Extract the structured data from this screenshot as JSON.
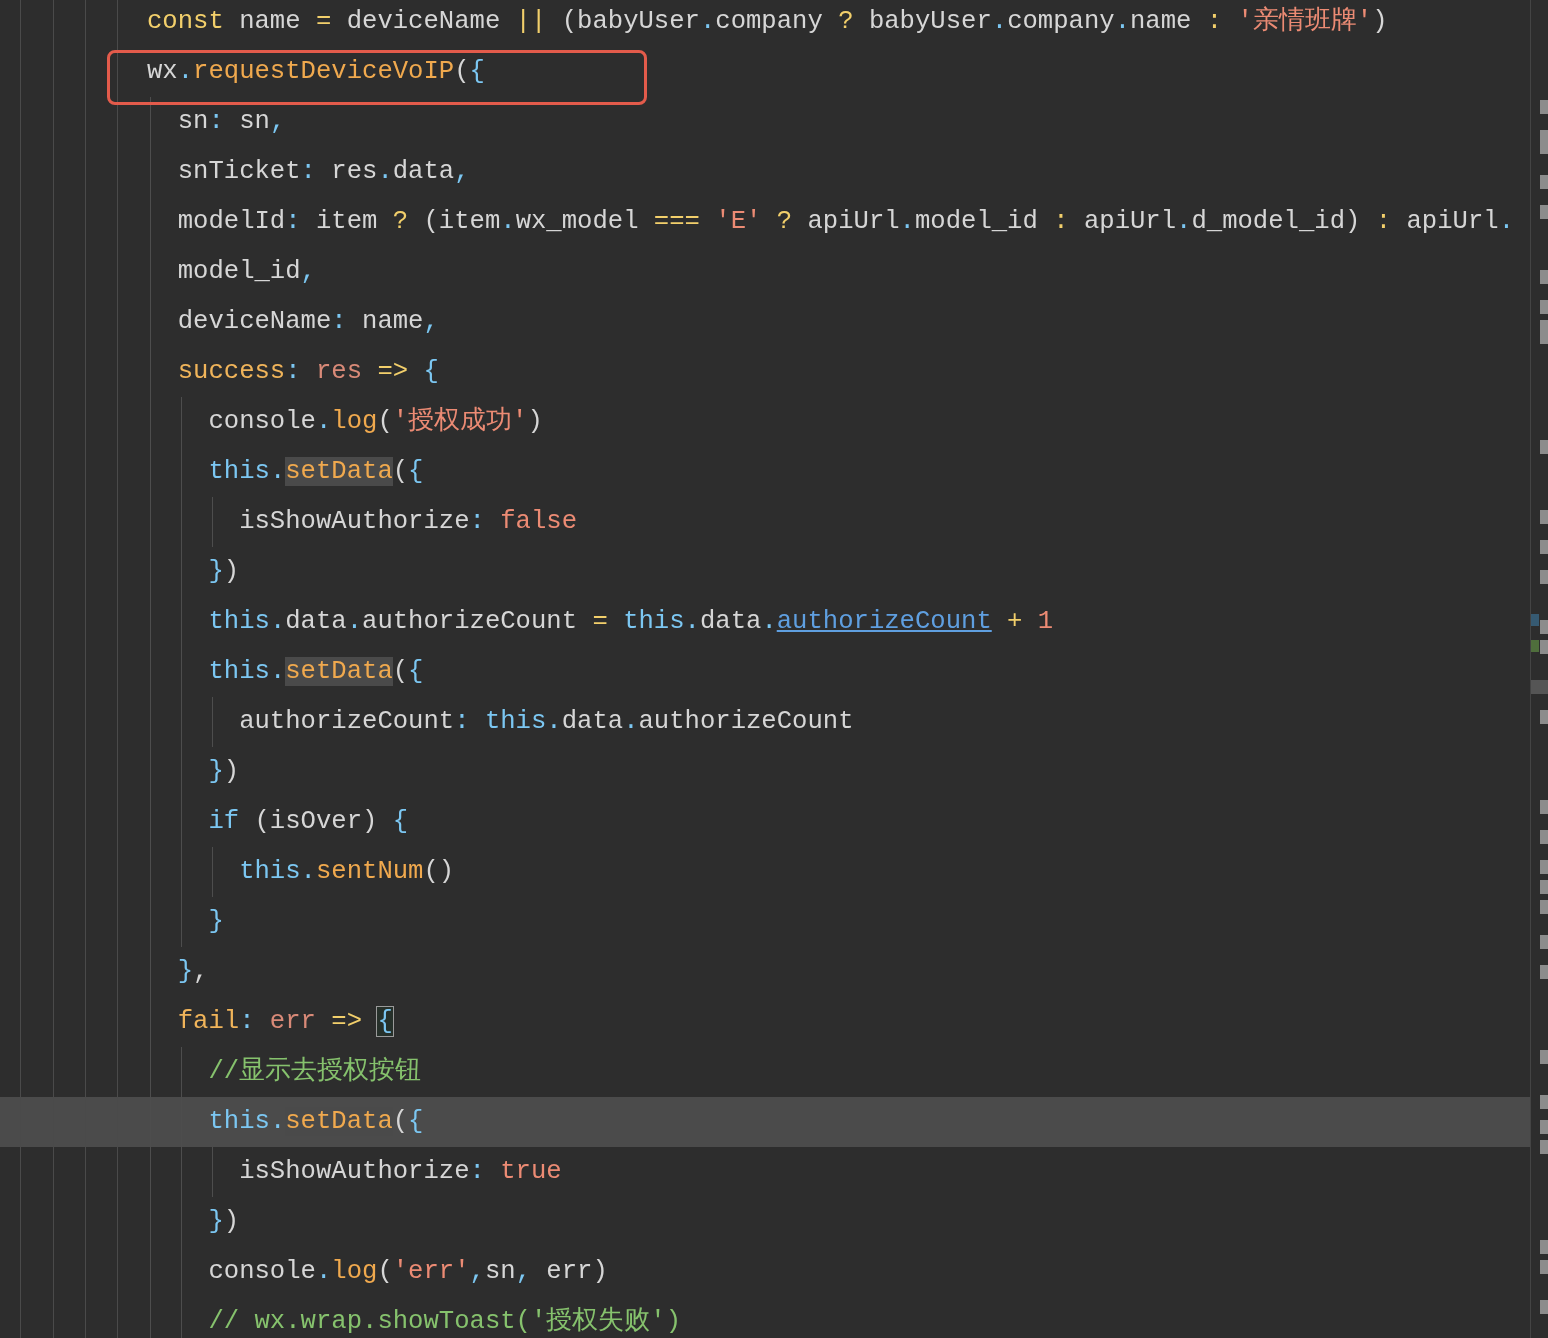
{
  "editor": {
    "lines": [
      {
        "current": false,
        "tokens": [
          {
            "kind": "kw",
            "text": "const"
          },
          {
            "kind": "id",
            "text": " name"
          },
          {
            "kind": "op",
            "text": " ="
          },
          {
            "kind": "id",
            "text": " deviceName"
          },
          {
            "kind": "op",
            "text": " ||"
          },
          {
            "kind": "id",
            "text": " (babyUser"
          },
          {
            "kind": "dot",
            "text": "."
          },
          {
            "kind": "id",
            "text": "company"
          },
          {
            "kind": "op",
            "text": " ?"
          },
          {
            "kind": "id",
            "text": " babyUser"
          },
          {
            "kind": "dot",
            "text": "."
          },
          {
            "kind": "id",
            "text": "company"
          },
          {
            "kind": "dot",
            "text": "."
          },
          {
            "kind": "id",
            "text": "name"
          },
          {
            "kind": "op",
            "text": " :"
          },
          {
            "kind": "str",
            "text": " '亲情班牌'"
          },
          {
            "kind": "id",
            "text": ")"
          }
        ]
      },
      {
        "current": false,
        "tokens": [
          {
            "kind": "id",
            "text": "wx"
          },
          {
            "kind": "dot",
            "text": "."
          },
          {
            "kind": "fn",
            "text": "requestDeviceVoIP"
          },
          {
            "kind": "id",
            "text": "("
          },
          {
            "kind": "brace",
            "text": "{"
          }
        ]
      },
      {
        "current": false,
        "tokens": [
          {
            "kind": "id",
            "text": "  sn"
          },
          {
            "kind": "dot",
            "text": ":"
          },
          {
            "kind": "id",
            "text": " sn"
          },
          {
            "kind": "dot",
            "text": ","
          }
        ]
      },
      {
        "current": false,
        "tokens": [
          {
            "kind": "id",
            "text": "  snTicket"
          },
          {
            "kind": "dot",
            "text": ":"
          },
          {
            "kind": "id",
            "text": " res"
          },
          {
            "kind": "dot",
            "text": "."
          },
          {
            "kind": "id",
            "text": "data"
          },
          {
            "kind": "dot",
            "text": ","
          }
        ]
      },
      {
        "current": false,
        "tokens": [
          {
            "kind": "id",
            "text": "  modelId"
          },
          {
            "kind": "dot",
            "text": ":"
          },
          {
            "kind": "id",
            "text": " item"
          },
          {
            "kind": "op",
            "text": " ?"
          },
          {
            "kind": "id",
            "text": " (item"
          },
          {
            "kind": "dot",
            "text": "."
          },
          {
            "kind": "id",
            "text": "wx_model"
          },
          {
            "kind": "op",
            "text": " ==="
          },
          {
            "kind": "str",
            "text": " 'E'"
          },
          {
            "kind": "op",
            "text": " ?"
          },
          {
            "kind": "id",
            "text": " apiUrl"
          },
          {
            "kind": "dot",
            "text": "."
          },
          {
            "kind": "id",
            "text": "model_id"
          },
          {
            "kind": "op",
            "text": " :"
          },
          {
            "kind": "id",
            "text": " apiUrl"
          },
          {
            "kind": "dot",
            "text": "."
          },
          {
            "kind": "id",
            "text": "d_model_id)"
          },
          {
            "kind": "op",
            "text": " :"
          },
          {
            "kind": "id",
            "text": " apiUrl"
          },
          {
            "kind": "dot",
            "text": "."
          }
        ]
      },
      {
        "current": false,
        "tokens": [
          {
            "kind": "id",
            "text": "  model_id"
          },
          {
            "kind": "dot",
            "text": ","
          }
        ]
      },
      {
        "current": false,
        "tokens": [
          {
            "kind": "id",
            "text": "  deviceName"
          },
          {
            "kind": "dot",
            "text": ":"
          },
          {
            "kind": "id",
            "text": " name"
          },
          {
            "kind": "dot",
            "text": ","
          }
        ]
      },
      {
        "current": false,
        "tokens": [
          {
            "kind": "prop",
            "text": "  success"
          },
          {
            "kind": "dot",
            "text": ":"
          },
          {
            "kind": "param",
            "text": " res"
          },
          {
            "kind": "op",
            "text": " =>"
          },
          {
            "kind": "brace",
            "text": " {"
          }
        ]
      },
      {
        "current": false,
        "tokens": [
          {
            "kind": "id",
            "text": "    console"
          },
          {
            "kind": "dot",
            "text": "."
          },
          {
            "kind": "fn",
            "text": "log"
          },
          {
            "kind": "id",
            "text": "("
          },
          {
            "kind": "str",
            "text": "'授权成功'"
          },
          {
            "kind": "id",
            "text": ")"
          }
        ]
      },
      {
        "current": false,
        "tokens": [
          {
            "kind": "this",
            "text": "    this"
          },
          {
            "kind": "dot",
            "text": "."
          },
          {
            "kind": "occurrence",
            "text": "setData"
          },
          {
            "kind": "id",
            "text": "("
          },
          {
            "kind": "brace",
            "text": "{"
          }
        ]
      },
      {
        "current": false,
        "tokens": [
          {
            "kind": "id",
            "text": "      isShowAuthorize"
          },
          {
            "kind": "dot",
            "text": ":"
          },
          {
            "kind": "lit",
            "text": " false"
          }
        ]
      },
      {
        "current": false,
        "tokens": [
          {
            "kind": "brace",
            "text": "    }"
          },
          {
            "kind": "id",
            "text": ")"
          }
        ]
      },
      {
        "current": false,
        "tokens": [
          {
            "kind": "this",
            "text": "    this"
          },
          {
            "kind": "dot",
            "text": "."
          },
          {
            "kind": "id",
            "text": "data"
          },
          {
            "kind": "dot",
            "text": "."
          },
          {
            "kind": "id",
            "text": "authorizeCount"
          },
          {
            "kind": "op",
            "text": " ="
          },
          {
            "kind": "this",
            "text": " this"
          },
          {
            "kind": "dot",
            "text": "."
          },
          {
            "kind": "id",
            "text": "data"
          },
          {
            "kind": "dot",
            "text": "."
          },
          {
            "kind": "link",
            "text": "authorizeCount"
          },
          {
            "kind": "op",
            "text": " +"
          },
          {
            "kind": "lit",
            "text": " 1"
          }
        ]
      },
      {
        "current": false,
        "tokens": [
          {
            "kind": "this",
            "text": "    this"
          },
          {
            "kind": "dot",
            "text": "."
          },
          {
            "kind": "occurrence",
            "text": "setData"
          },
          {
            "kind": "id",
            "text": "("
          },
          {
            "kind": "brace",
            "text": "{"
          }
        ]
      },
      {
        "current": false,
        "tokens": [
          {
            "kind": "id",
            "text": "      authorizeCount"
          },
          {
            "kind": "dot",
            "text": ":"
          },
          {
            "kind": "this",
            "text": " this"
          },
          {
            "kind": "dot",
            "text": "."
          },
          {
            "kind": "id",
            "text": "data"
          },
          {
            "kind": "dot",
            "text": "."
          },
          {
            "kind": "id",
            "text": "authorizeCount"
          }
        ]
      },
      {
        "current": false,
        "tokens": [
          {
            "kind": "brace",
            "text": "    }"
          },
          {
            "kind": "id",
            "text": ")"
          }
        ]
      },
      {
        "current": false,
        "tokens": [
          {
            "kind": "this",
            "text": "    if"
          },
          {
            "kind": "id",
            "text": " (isOver)"
          },
          {
            "kind": "brace",
            "text": " {"
          }
        ]
      },
      {
        "current": false,
        "tokens": [
          {
            "kind": "this",
            "text": "      this"
          },
          {
            "kind": "dot",
            "text": "."
          },
          {
            "kind": "fn",
            "text": "sentNum"
          },
          {
            "kind": "id",
            "text": "()"
          }
        ]
      },
      {
        "current": false,
        "tokens": [
          {
            "kind": "brace",
            "text": "    }"
          }
        ]
      },
      {
        "current": false,
        "tokens": [
          {
            "kind": "brace",
            "text": "  }"
          },
          {
            "kind": "id",
            "text": ","
          }
        ]
      },
      {
        "current": false,
        "tokens": [
          {
            "kind": "prop",
            "text": "  fail"
          },
          {
            "kind": "dot",
            "text": ":"
          },
          {
            "kind": "param",
            "text": " err"
          },
          {
            "kind": "op",
            "text": " => "
          },
          {
            "kind": "match",
            "text": "{"
          }
        ]
      },
      {
        "current": false,
        "tokens": [
          {
            "kind": "com",
            "text": "    //显示去授权按钮"
          }
        ]
      },
      {
        "current": true,
        "tokens": [
          {
            "kind": "this",
            "text": "    this"
          },
          {
            "kind": "dot",
            "text": "."
          },
          {
            "kind": "occurrence",
            "text": "setData"
          },
          {
            "kind": "id",
            "text": "("
          },
          {
            "kind": "brace",
            "text": "{"
          }
        ]
      },
      {
        "current": false,
        "tokens": [
          {
            "kind": "id",
            "text": "      isShowAuthorize"
          },
          {
            "kind": "dot",
            "text": ":"
          },
          {
            "kind": "lit",
            "text": " true"
          }
        ]
      },
      {
        "current": false,
        "tokens": [
          {
            "kind": "brace",
            "text": "    }"
          },
          {
            "kind": "id",
            "text": ")"
          }
        ]
      },
      {
        "current": false,
        "tokens": [
          {
            "kind": "id",
            "text": "    console"
          },
          {
            "kind": "dot",
            "text": "."
          },
          {
            "kind": "fn",
            "text": "log"
          },
          {
            "kind": "id",
            "text": "("
          },
          {
            "kind": "str",
            "text": "'err'"
          },
          {
            "kind": "dot",
            "text": ","
          },
          {
            "kind": "id",
            "text": "sn"
          },
          {
            "kind": "dot",
            "text": ","
          },
          {
            "kind": "id",
            "text": " err)"
          }
        ]
      },
      {
        "current": false,
        "tokens": [
          {
            "kind": "com",
            "text": "    // wx.wrap.showToast('授权失败')"
          }
        ]
      }
    ]
  }
}
